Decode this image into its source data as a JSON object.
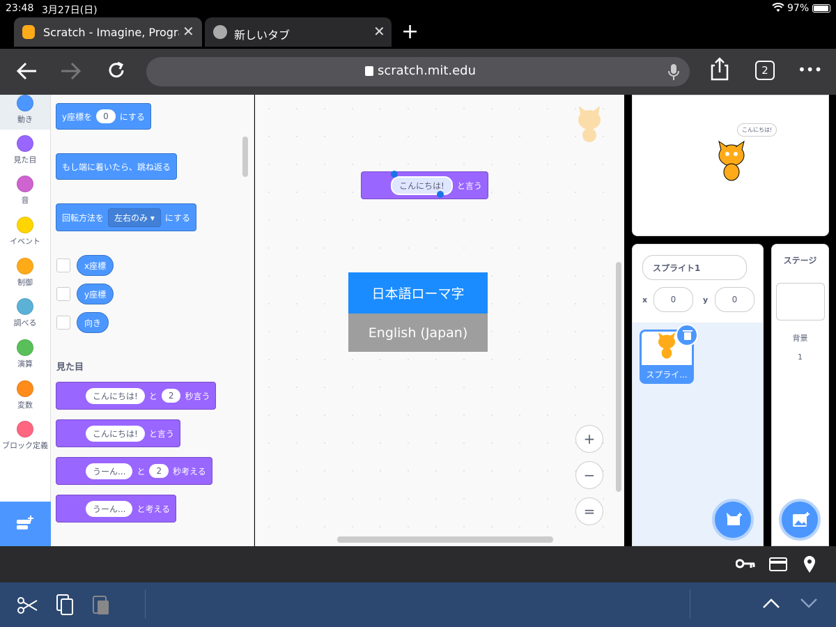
{
  "status": {
    "time": "23:48",
    "date": "3月27日(日)",
    "battery": "97%"
  },
  "tabs": [
    {
      "title": "Scratch - Imagine, Progra",
      "close": "✕"
    },
    {
      "title": "新しいタブ",
      "close": "✕"
    }
  ],
  "new_tab": "+",
  "browser": {
    "url": "scratch.mit.edu",
    "tab_count": "2",
    "more": "•••"
  },
  "categories": [
    {
      "label": "動き",
      "color": "#4c97ff"
    },
    {
      "label": "見た目",
      "color": "#9966ff"
    },
    {
      "label": "音",
      "color": "#cf63cf"
    },
    {
      "label": "イベント",
      "color": "#ffd500"
    },
    {
      "label": "制御",
      "color": "#ffab19"
    },
    {
      "label": "調べる",
      "color": "#5cb1d6"
    },
    {
      "label": "演算",
      "color": "#59c059"
    },
    {
      "label": "変数",
      "color": "#ff8c1a"
    },
    {
      "label": "ブロック定義",
      "color": "#ff6680"
    }
  ],
  "palette": {
    "set_y": {
      "pre": "y座標を",
      "val": "0",
      "post": "にする"
    },
    "bounce": "もし端に着いたら、跳ね返る",
    "rotation": {
      "pre": "回転方法を",
      "val": "左右のみ",
      "post": "にする"
    },
    "reporters": [
      "x座標",
      "y座標",
      "向き"
    ],
    "looks_heading": "見た目",
    "say_secs": {
      "text": "こんにちは!",
      "mid": "と",
      "secs": "2",
      "post": "秒言う"
    },
    "say": {
      "text": "こんにちは!",
      "post": "と言う"
    },
    "think_secs": {
      "text": "うーん...",
      "mid": "と",
      "secs": "2",
      "post": "秒考える"
    },
    "think": {
      "text": "うーん...",
      "post": "と考える"
    }
  },
  "workspace": {
    "say_block": {
      "text": "こんにちは!",
      "post": "と言う"
    },
    "ime_options": [
      "日本語ローマ字",
      "English (Japan)"
    ],
    "zoom": {
      "in": "+",
      "out": "−",
      "reset": "="
    }
  },
  "stage": {
    "bubble": "こんにちは!"
  },
  "sprite_info": {
    "name": "スプライト1",
    "x_label": "x",
    "x": "0",
    "y_label": "y",
    "y": "0",
    "thumb_label": "スプライ..."
  },
  "stage_panel": {
    "title": "ステージ",
    "backdrop_label": "背景",
    "backdrop_count": "1"
  }
}
